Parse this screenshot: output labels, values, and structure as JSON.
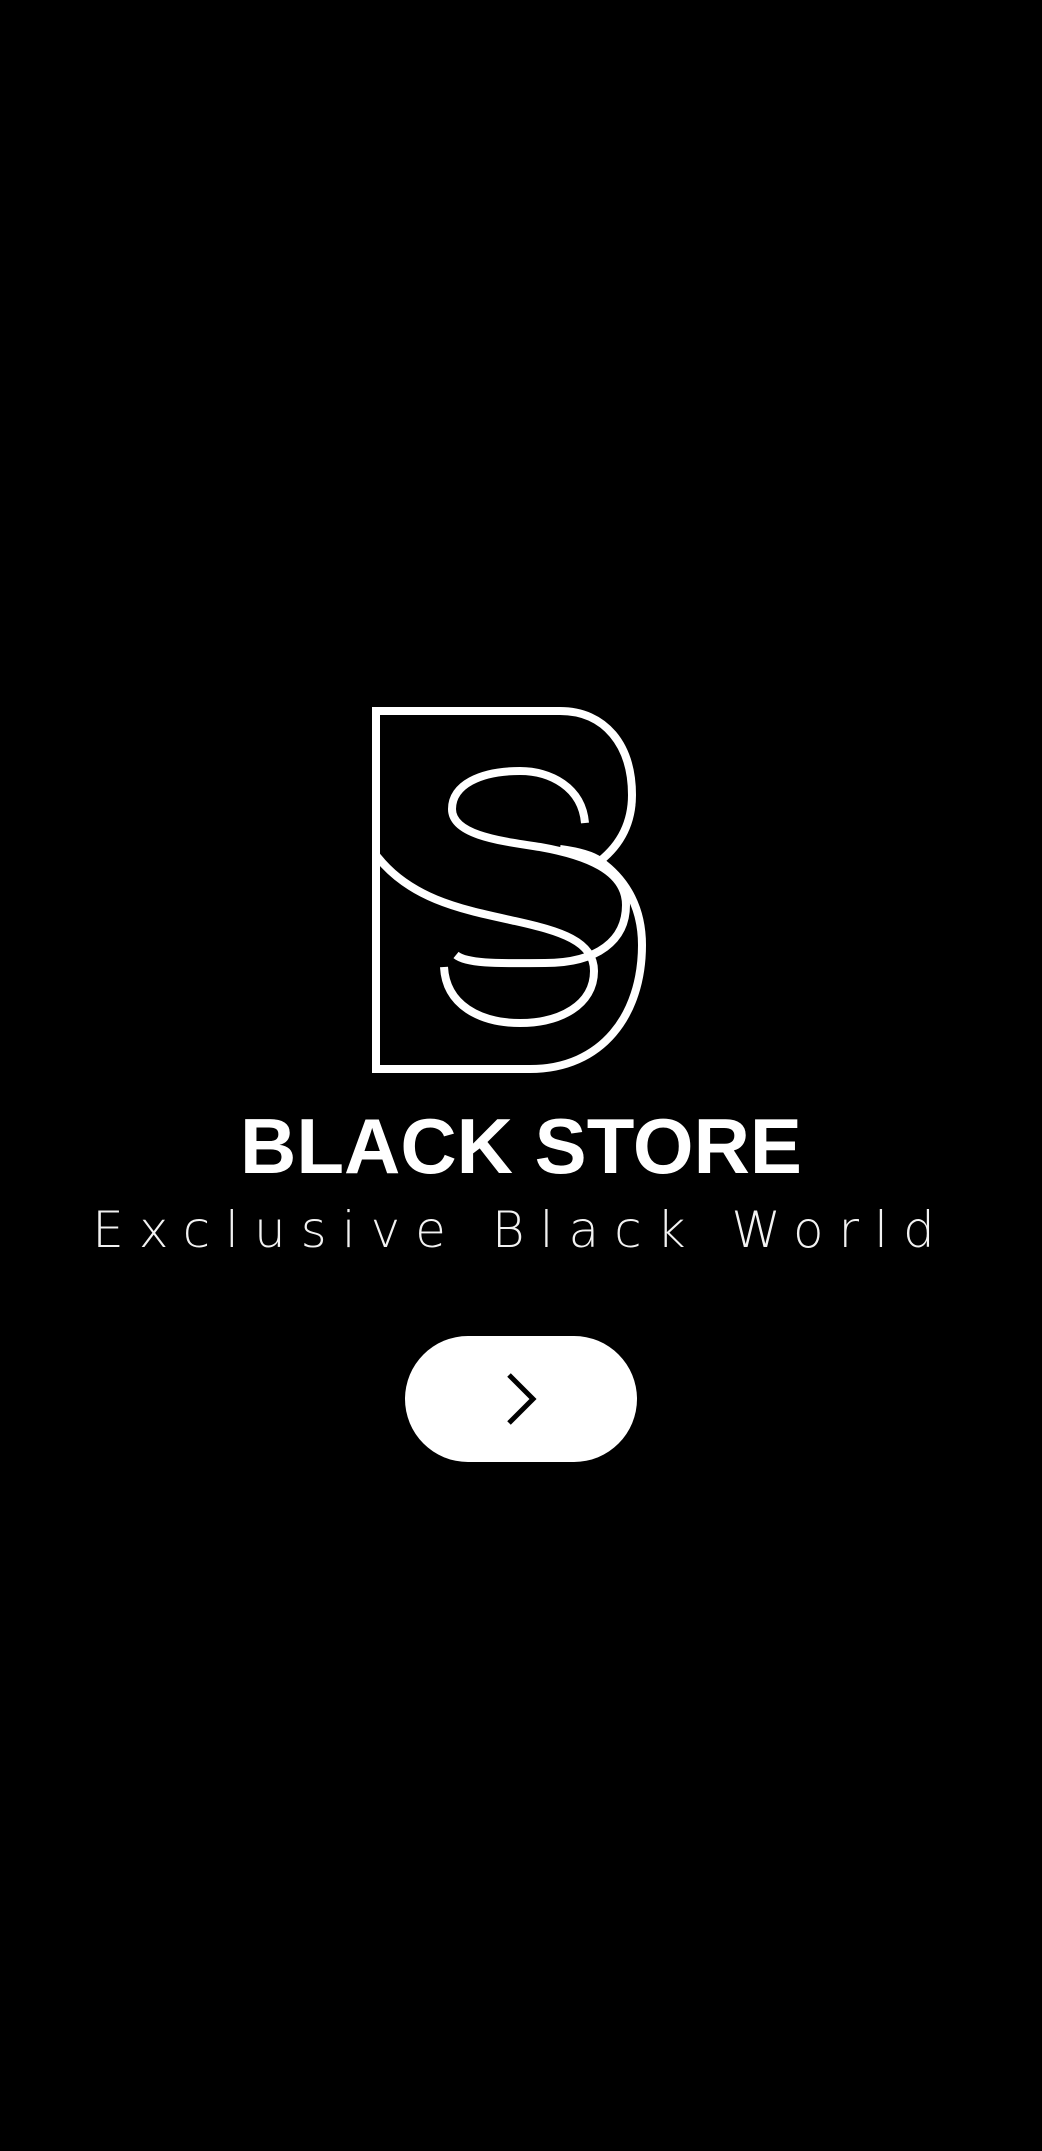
{
  "app": {
    "brand_name": "BLACK STORE",
    "tagline": "Exclusive Black World"
  },
  "logo": {
    "icon": "bs-monogram-logo",
    "color": "#ffffff"
  },
  "next_button": {
    "icon": "chevron-right-icon",
    "background": "#ffffff",
    "icon_color": "#000000"
  },
  "theme": {
    "background": "#000000",
    "foreground": "#ffffff"
  }
}
